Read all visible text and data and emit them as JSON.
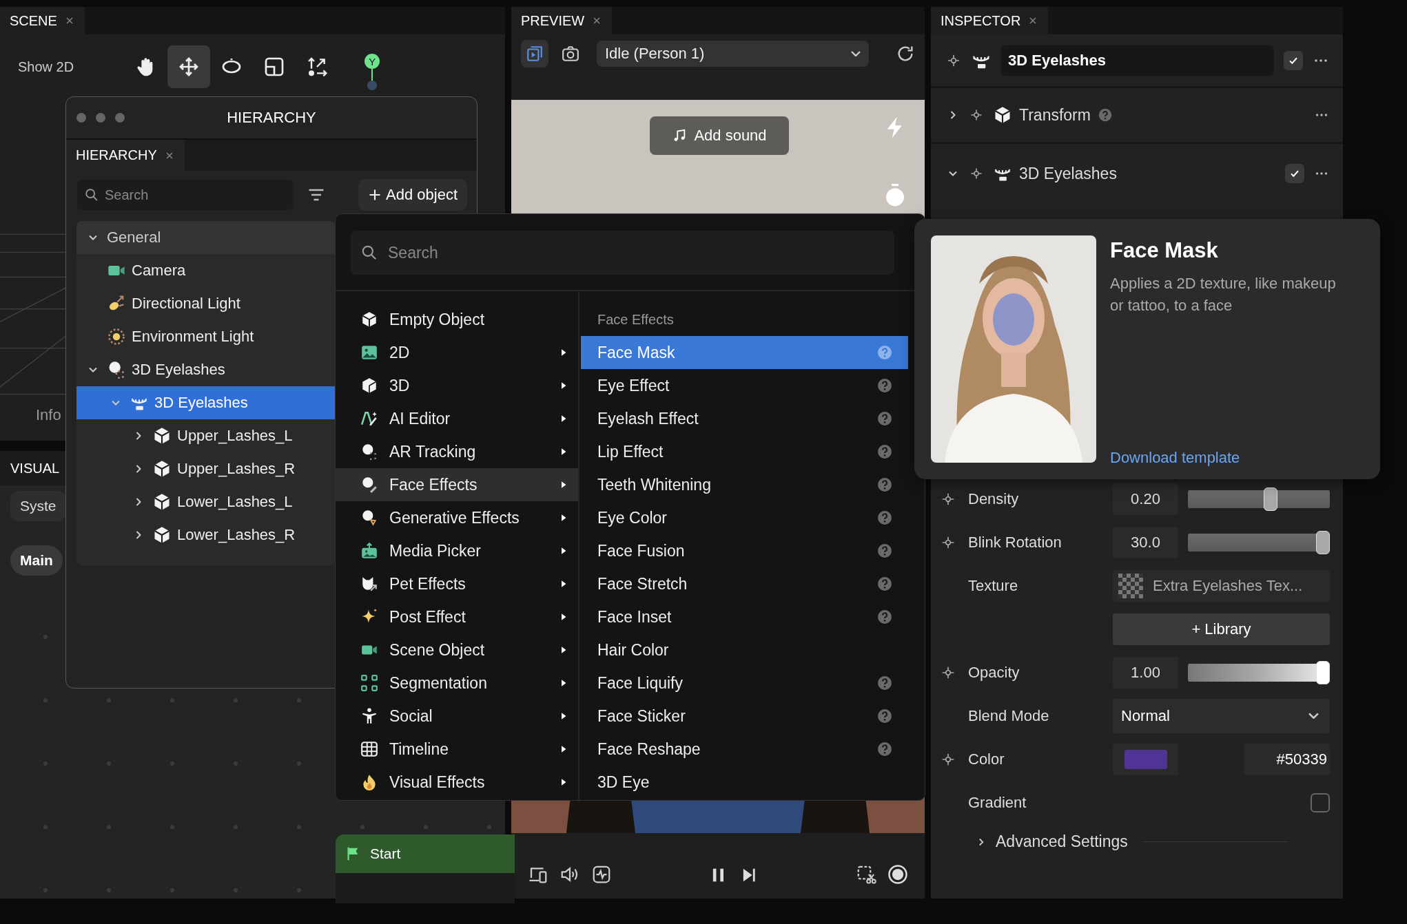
{
  "scene": {
    "tab": "SCENE",
    "show_2d": "Show 2D",
    "tools": [
      {
        "selected": false
      },
      {
        "selected": true
      },
      {
        "selected": false
      },
      {
        "selected": false
      },
      {
        "selected": false
      }
    ],
    "axis": "Y",
    "info": "Info"
  },
  "visual": {
    "tab": "VISUAL",
    "pills": [
      {
        "label": "Syste",
        "selected": false
      },
      {
        "label": "Main",
        "selected": true
      }
    ],
    "start_node": "Start"
  },
  "preview": {
    "tab": "PREVIEW",
    "modes": [
      {
        "selected": true
      },
      {
        "selected": false
      }
    ],
    "animation": "Idle (Person 1)",
    "add_sound": "Add sound"
  },
  "inspector": {
    "tab": "INSPECTOR",
    "object": {
      "name": "3D Eyelashes",
      "checked": true
    },
    "components": [
      {
        "name": "Transform",
        "expanded": false,
        "help": true
      },
      {
        "name": "3D Eyelashes",
        "expanded": true,
        "checked": true
      }
    ],
    "properties": [
      {
        "kind": "slider",
        "label": "Density",
        "value": "0.20",
        "level": 0.59,
        "keyframe": true
      },
      {
        "kind": "slider",
        "label": "Blink Rotation",
        "value": "30.0",
        "level": 1,
        "keyframe": true
      },
      {
        "kind": "texture",
        "label": "Texture",
        "value": "Extra Eyelashes Tex...",
        "keyframe": false
      },
      {
        "kind": "button",
        "value": "+ Library"
      },
      {
        "kind": "alpha-slider",
        "label": "Opacity",
        "value": "1.00",
        "level": 1,
        "keyframe": true
      },
      {
        "kind": "dropdown",
        "label": "Blend Mode",
        "value": "Normal",
        "keyframe": false
      },
      {
        "kind": "color",
        "label": "Color",
        "color": "#4f3496",
        "value": "#50339",
        "keyframe": true
      },
      {
        "kind": "checkbox",
        "label": "Gradient",
        "checked": false,
        "keyframe": false
      }
    ],
    "advanced": "Advanced Settings"
  },
  "hierarchy": {
    "title": "HIERARCHY",
    "tab": "HIERARCHY",
    "search_placeholder": "Search",
    "add_object": "Add object",
    "tree": [
      {
        "label": "General",
        "expanded": true,
        "selected": false,
        "children": [
          {
            "label": "Camera",
            "kind": "camera",
            "selected": false
          },
          {
            "label": "Directional Light",
            "kind": "directional-light",
            "selected": false
          },
          {
            "label": "Environment Light",
            "kind": "environment-light",
            "selected": false
          },
          {
            "label": "3D Eyelashes",
            "kind": "effect",
            "expanded": true,
            "selected": false,
            "children": [
              {
                "label": "3D Eyelashes",
                "kind": "eyelashes",
                "expanded": true,
                "selected": true,
                "children": [
                  {
                    "label": "Upper_Lashes_L",
                    "kind": "mesh",
                    "expanded": false,
                    "selected": false
                  },
                  {
                    "label": "Upper_Lashes_R",
                    "kind": "mesh",
                    "expanded": false,
                    "selected": false
                  },
                  {
                    "label": "Lower_Lashes_L",
                    "kind": "mesh",
                    "expanded": false,
                    "selected": false
                  },
                  {
                    "label": "Lower_Lashes_R",
                    "kind": "mesh",
                    "expanded": false,
                    "selected": false
                  }
                ]
              }
            ]
          }
        ]
      }
    ]
  },
  "menu": {
    "search_placeholder": "Search",
    "categories": [
      {
        "label": "Empty Object",
        "selected": false,
        "submenu": false
      },
      {
        "label": "2D",
        "selected": false,
        "submenu": true
      },
      {
        "label": "3D",
        "selected": false,
        "submenu": true
      },
      {
        "label": "AI Editor",
        "selected": false,
        "submenu": true
      },
      {
        "label": "AR Tracking",
        "selected": false,
        "submenu": true
      },
      {
        "label": "Face Effects",
        "selected": true,
        "submenu": true
      },
      {
        "label": "Generative Effects",
        "selected": false,
        "submenu": true
      },
      {
        "label": "Media Picker",
        "selected": false,
        "submenu": true
      },
      {
        "label": "Pet Effects",
        "selected": false,
        "submenu": true
      },
      {
        "label": "Post Effect",
        "selected": false,
        "submenu": true
      },
      {
        "label": "Scene Object",
        "selected": false,
        "submenu": true
      },
      {
        "label": "Segmentation",
        "selected": false,
        "submenu": true
      },
      {
        "label": "Social",
        "selected": false,
        "submenu": true
      },
      {
        "label": "Timeline",
        "selected": false,
        "submenu": true
      },
      {
        "label": "Visual Effects",
        "selected": false,
        "submenu": true
      }
    ],
    "section": "Face Effects",
    "items": [
      {
        "label": "Face Mask",
        "selected": true,
        "help": true
      },
      {
        "label": "Eye Effect",
        "selected": false,
        "help": true
      },
      {
        "label": "Eyelash Effect",
        "selected": false,
        "help": true
      },
      {
        "label": "Lip Effect",
        "selected": false,
        "help": true
      },
      {
        "label": "Teeth Whitening",
        "selected": false,
        "help": true
      },
      {
        "label": "Eye Color",
        "selected": false,
        "help": true
      },
      {
        "label": "Face Fusion",
        "selected": false,
        "help": true
      },
      {
        "label": "Face Stretch",
        "selected": false,
        "help": true
      },
      {
        "label": "Face Inset",
        "selected": false,
        "help": true
      },
      {
        "label": "Hair Color",
        "selected": false,
        "help": false
      },
      {
        "label": "Face Liquify",
        "selected": false,
        "help": true
      },
      {
        "label": "Face Sticker",
        "selected": false,
        "help": true
      },
      {
        "label": "Face Reshape",
        "selected": false,
        "help": true
      },
      {
        "label": "3D Eye",
        "selected": false,
        "help": false
      }
    ]
  },
  "tooltip": {
    "title": "Face Mask",
    "description": "Applies a 2D texture, like makeup or tattoo, to a face",
    "link": "Download template"
  }
}
